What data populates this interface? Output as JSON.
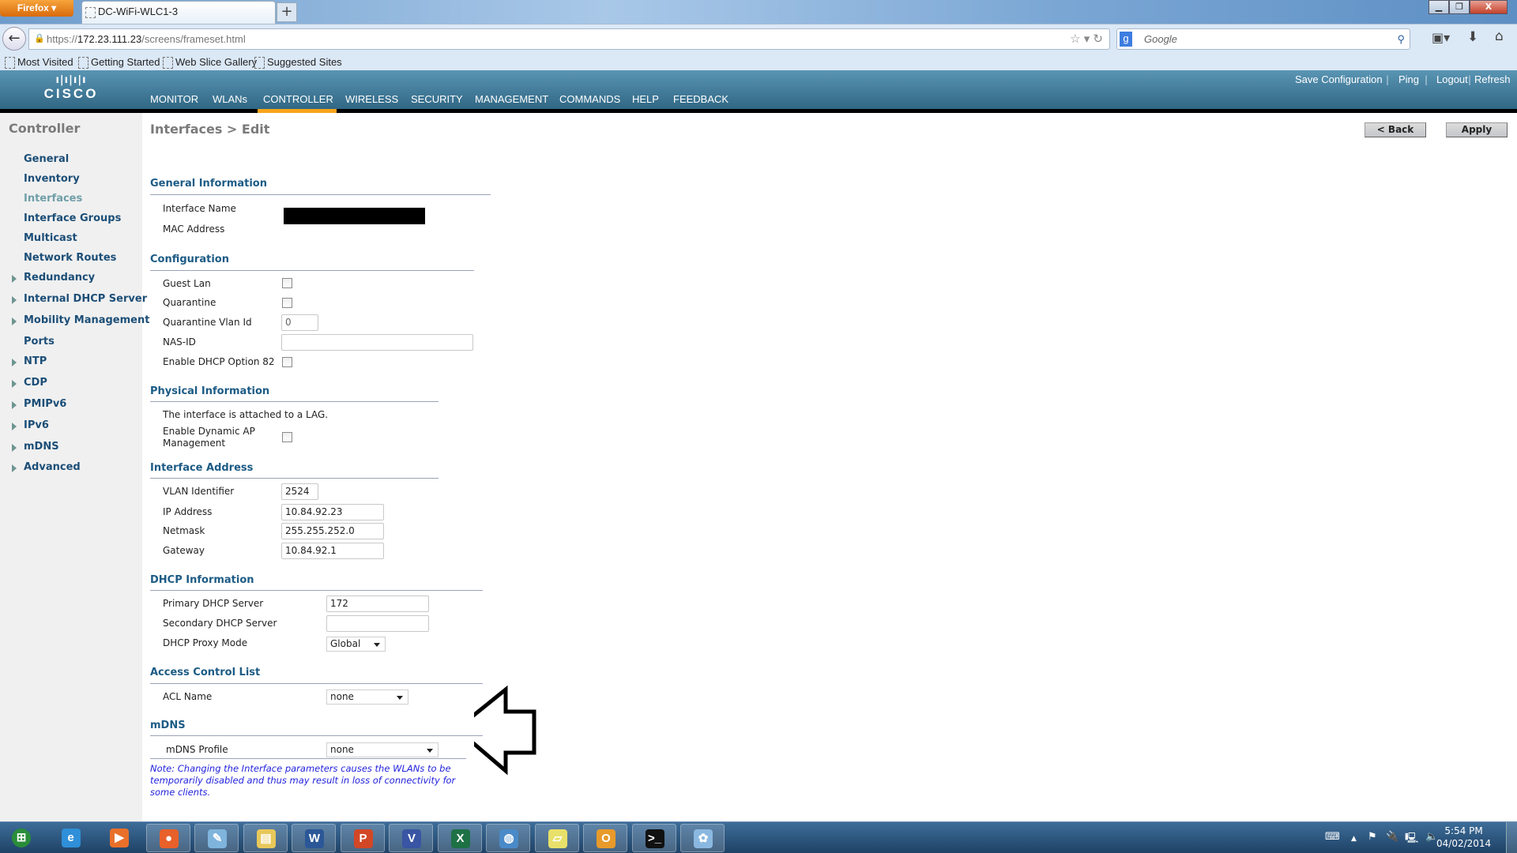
{
  "browser": {
    "app_button": "Firefox",
    "tab_title": "DC-WiFi-WLC1-3",
    "new_tab": "+",
    "url_prefix": "https://",
    "url_host": "172.23.111.23",
    "url_path": "/screens/frameset.html",
    "search_placeholder": "Google",
    "search_engine_icon": "g",
    "bookmarks": [
      "Most Visited",
      "Getting Started",
      "Web Slice Gallery",
      "Suggested Sites"
    ]
  },
  "header": {
    "brand": "CISCO",
    "menu": [
      "MONITOR",
      "WLANs",
      "CONTROLLER",
      "WIRELESS",
      "SECURITY",
      "MANAGEMENT",
      "COMMANDS",
      "HELP",
      "FEEDBACK"
    ],
    "active_menu": "CONTROLLER",
    "accent": "#f7a41c",
    "links": [
      "Save Configuration",
      "Ping",
      "Logout",
      "Refresh"
    ]
  },
  "sidebar": {
    "title": "Controller",
    "items": [
      {
        "label": "General",
        "expandable": false
      },
      {
        "label": "Inventory",
        "expandable": false
      },
      {
        "label": "Interfaces",
        "expandable": false,
        "active": true
      },
      {
        "label": "Interface Groups",
        "expandable": false
      },
      {
        "label": "Multicast",
        "expandable": false
      },
      {
        "label": "Network Routes",
        "expandable": false
      },
      {
        "label": "Redundancy",
        "expandable": true
      },
      {
        "label": "Internal DHCP Server",
        "expandable": true
      },
      {
        "label": "Mobility Management",
        "expandable": true
      },
      {
        "label": "Ports",
        "expandable": false
      },
      {
        "label": "NTP",
        "expandable": true
      },
      {
        "label": "CDP",
        "expandable": true
      },
      {
        "label": "PMIPv6",
        "expandable": true
      },
      {
        "label": "IPv6",
        "expandable": true
      },
      {
        "label": "mDNS",
        "expandable": true
      },
      {
        "label": "Advanced",
        "expandable": true
      }
    ]
  },
  "page": {
    "title": "Interfaces > Edit",
    "back": "< Back",
    "apply": "Apply"
  },
  "general": {
    "heading": "General Information",
    "interface_name_label": "Interface Name",
    "mac_label": "MAC Address"
  },
  "config": {
    "heading": "Configuration",
    "guest_lan": "Guest Lan",
    "guest_lan_checked": false,
    "quarantine": "Quarantine",
    "quarantine_checked": false,
    "qvlan_label": "Quarantine Vlan Id",
    "qvlan_value": "0",
    "nasid_label": "NAS-ID",
    "nasid_value": "",
    "opt82": "Enable DHCP Option 82",
    "opt82_checked": false
  },
  "physical": {
    "heading": "Physical Information",
    "lag_text": "The interface is attached to a LAG.",
    "dyn_ap_1": "Enable Dynamic AP",
    "dyn_ap_2": "Management",
    "dyn_ap_checked": false
  },
  "address": {
    "heading": "Interface Address",
    "vlan_label": "VLAN Identifier",
    "vlan": "2524",
    "ip_label": "IP Address",
    "ip": "10.84.92.23",
    "mask_label": "Netmask",
    "mask": "255.255.252.0",
    "gw_label": "Gateway",
    "gw": "10.84.92.1"
  },
  "dhcp": {
    "heading": "DHCP Information",
    "primary_label": "Primary DHCP Server",
    "primary": "172",
    "secondary_label": "Secondary DHCP Server",
    "secondary": "",
    "proxy_label": "DHCP Proxy Mode",
    "proxy": "Global"
  },
  "acl": {
    "heading": "Access Control List",
    "name_label": "ACL Name",
    "name": "none"
  },
  "mdns": {
    "heading": "mDNS",
    "profile_label": "mDNS Profile",
    "profile": "none"
  },
  "note": "Note: Changing the Interface parameters causes the WLANs to be temporarily disabled and thus may result in loss of connectivity for some clients.",
  "taskbar": {
    "apps": [
      "start",
      "internet-explorer",
      "media-player",
      "firefox",
      "notepad",
      "file-explorer",
      "word",
      "powerpoint",
      "visio",
      "excel",
      "network",
      "sticky-notes",
      "outlook",
      "command-prompt",
      "paint"
    ],
    "time": "5:54 PM",
    "date": "04/02/2014"
  }
}
